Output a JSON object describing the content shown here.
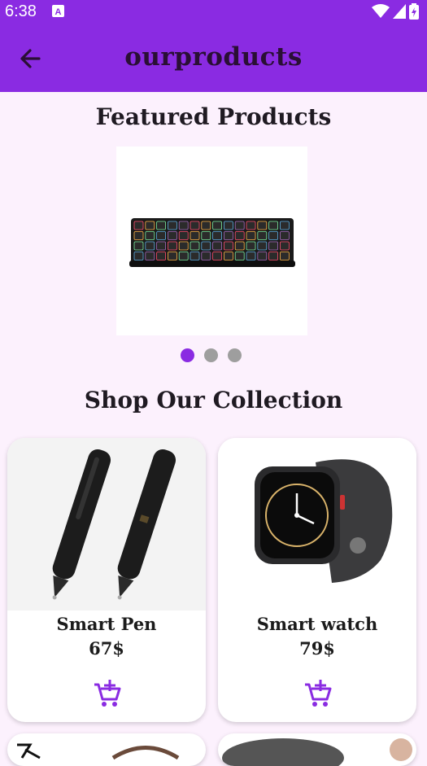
{
  "status_bar": {
    "time": "6:38",
    "notif_letter": "A"
  },
  "app_bar": {
    "title": "ourproducts",
    "back_icon": "arrow-left-icon"
  },
  "featured": {
    "title": "Featured Products",
    "active_index": 0,
    "slide_count": 3
  },
  "collection": {
    "title": "Shop Our Collection",
    "products": [
      {
        "name": "Smart Pen",
        "price": "67$"
      },
      {
        "name": "Smart watch",
        "price": "79$"
      }
    ]
  },
  "colors": {
    "primary": "#8a2be2",
    "background": "#fcf1fd",
    "accent_icon": "#8a2be2"
  }
}
